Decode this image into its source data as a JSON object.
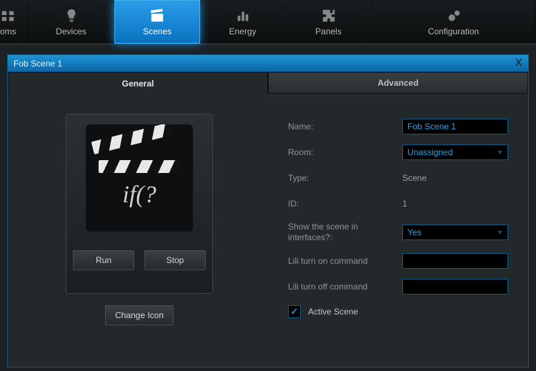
{
  "nav": {
    "items": [
      {
        "label": "oms"
      },
      {
        "label": "Devices"
      },
      {
        "label": "Scenes"
      },
      {
        "label": "Energy"
      },
      {
        "label": "Panels"
      },
      {
        "label": "Configuration"
      }
    ],
    "active_index": 2
  },
  "panel": {
    "title": "Fob Scene 1",
    "close_glyph": "X",
    "subtabs": {
      "general": "General",
      "advanced": "Advanced",
      "active": "general"
    }
  },
  "general": {
    "preview_text": "if(?",
    "run_label": "Run",
    "stop_label": "Stop",
    "change_icon_label": "Change Icon"
  },
  "form": {
    "name_label": "Name:",
    "name_value": "Fob Scene 1",
    "room_label": "Room:",
    "room_value": "Unassigned",
    "type_label": "Type:",
    "type_value": "Scene",
    "id_label": "ID:",
    "id_value": "1",
    "show_label": "Show the scene in interfaces?:",
    "show_value": "Yes",
    "lili_on_label": "Lili turn on command",
    "lili_on_value": "",
    "lili_off_label": "Lili turn off command",
    "lili_off_value": "",
    "active_scene_label": "Active Scene",
    "active_scene_checked": true
  }
}
